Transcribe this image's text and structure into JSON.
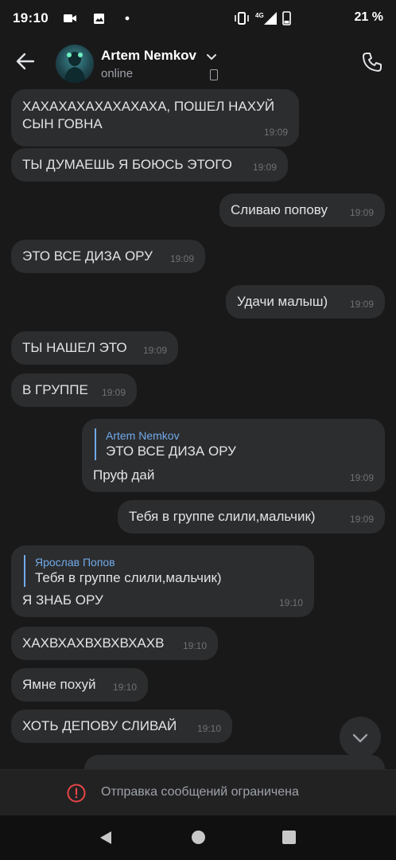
{
  "status_bar": {
    "time": "19:10",
    "battery_percent": "21 %",
    "network": "4G"
  },
  "header": {
    "contact_name": "Artem Nemkov",
    "status": "online",
    "avatar_icon": "avatar-icon",
    "back_icon": "arrow-left-icon",
    "call_icon": "phone-icon"
  },
  "messages": [
    {
      "side": "in",
      "text": "ХАХАХАХАХАХАХАХА, ПОШЕЛ НАХУЙ СЫН ГОВНА",
      "time": "19:09"
    },
    {
      "side": "in",
      "text": "ТЫ ДУМАЕШЬ Я БОЮСЬ ЭТОГО",
      "time": "19:09"
    },
    {
      "side": "out",
      "text": "Сливаю попову",
      "time": "19:09"
    },
    {
      "side": "in",
      "text": "ЭТО ВСЕ ДИЗА ОРУ",
      "time": "19:09"
    },
    {
      "side": "out",
      "text": "Удачи малыш)",
      "time": "19:09"
    },
    {
      "side": "in",
      "text": "ТЫ НАШЕЛ ЭТО",
      "time": "19:09"
    },
    {
      "side": "in",
      "text": "В ГРУППЕ",
      "time": "19:09"
    },
    {
      "side": "out",
      "reply_name": "Artem Nemkov",
      "reply_text": "ЭТО ВСЕ ДИЗА ОРУ",
      "text": "Пруф дай",
      "time": "19:09"
    },
    {
      "side": "out",
      "text": "Тебя в группе слили,мальчик)",
      "time": "19:09"
    },
    {
      "side": "in",
      "reply_name": "Ярослав Попов",
      "reply_text": "Тебя в группе слили,мальчик)",
      "text": "Я ЗНАБ ОРУ",
      "time": "19:10"
    },
    {
      "side": "in",
      "text": "ХАХВХАХВХВХВХАХВ",
      "time": "19:10"
    },
    {
      "side": "in",
      "text": "Ямне похуй",
      "time": "19:10"
    },
    {
      "side": "in",
      "text": "ХОТЬ ДЕПОВУ СЛИВАЙ",
      "time": "19:10"
    }
  ],
  "restricted_notice": "Отправка сообщений ограничена",
  "colors": {
    "background": "#19191a",
    "bubble": "#2c2d2e",
    "accent": "#71aaeb",
    "warning": "#e64646"
  }
}
